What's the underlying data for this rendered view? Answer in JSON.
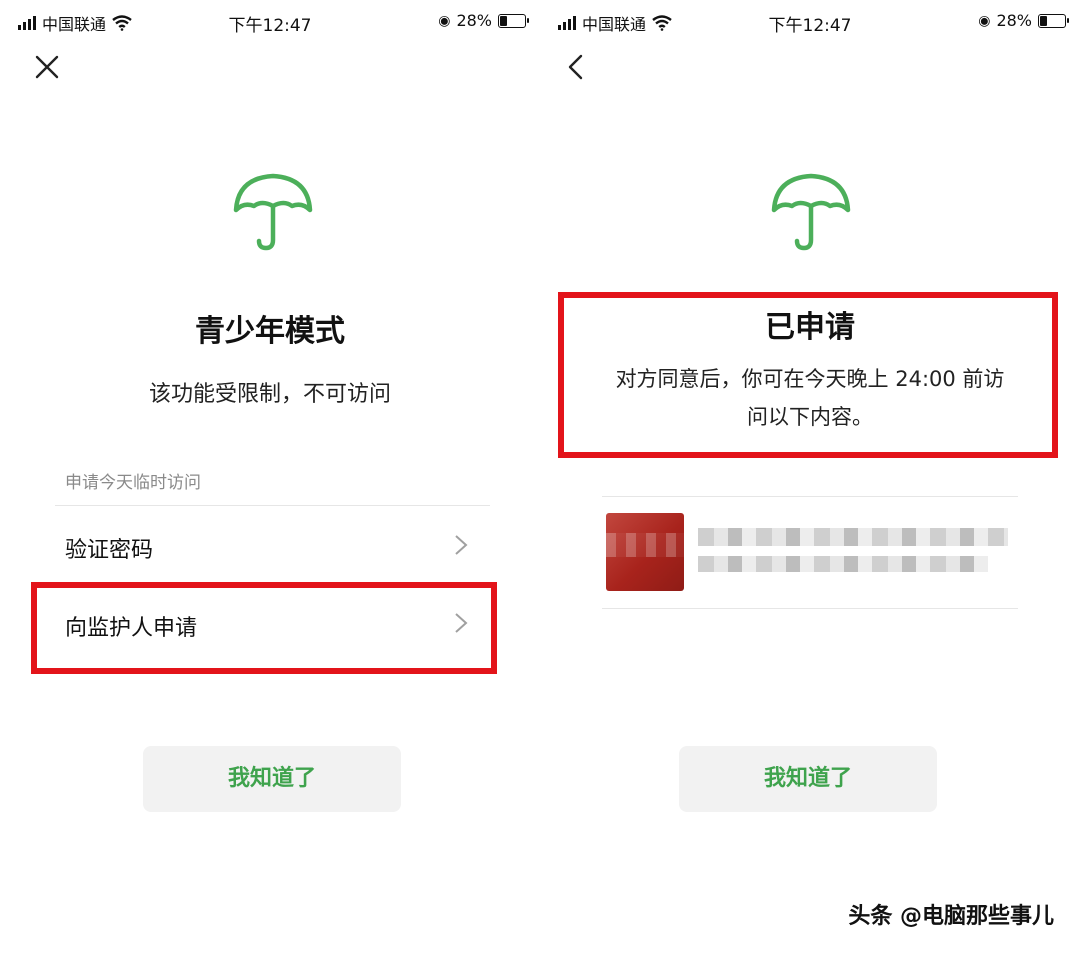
{
  "status_bar": {
    "left": {
      "carrier": "中国联通",
      "time": "下午12:47",
      "battery": "28%"
    },
    "right": {
      "carrier": "中国联通",
      "time": "下午12:47",
      "battery": "28%"
    }
  },
  "left_screen": {
    "title": "青少年模式",
    "subtitle": "该功能受限制，不可访问",
    "section_label": "申请今天临时访问",
    "options": [
      {
        "label": "验证密码"
      },
      {
        "label": "向监护人申请"
      }
    ],
    "ok_button": "我知道了"
  },
  "right_screen": {
    "title": "已申请",
    "description_line1": "对方同意后，你可在今天晚上 24:00 前访",
    "description_line2": "问以下内容。",
    "ok_button": "我知道了"
  },
  "watermark": "头条 @电脑那些事儿",
  "colors": {
    "accent_green": "#3fa34d",
    "highlight_red": "#e3141a"
  },
  "icons": [
    "close-icon",
    "back-icon",
    "umbrella-icon",
    "chevron-right-icon",
    "wifi-icon",
    "battery-icon"
  ]
}
